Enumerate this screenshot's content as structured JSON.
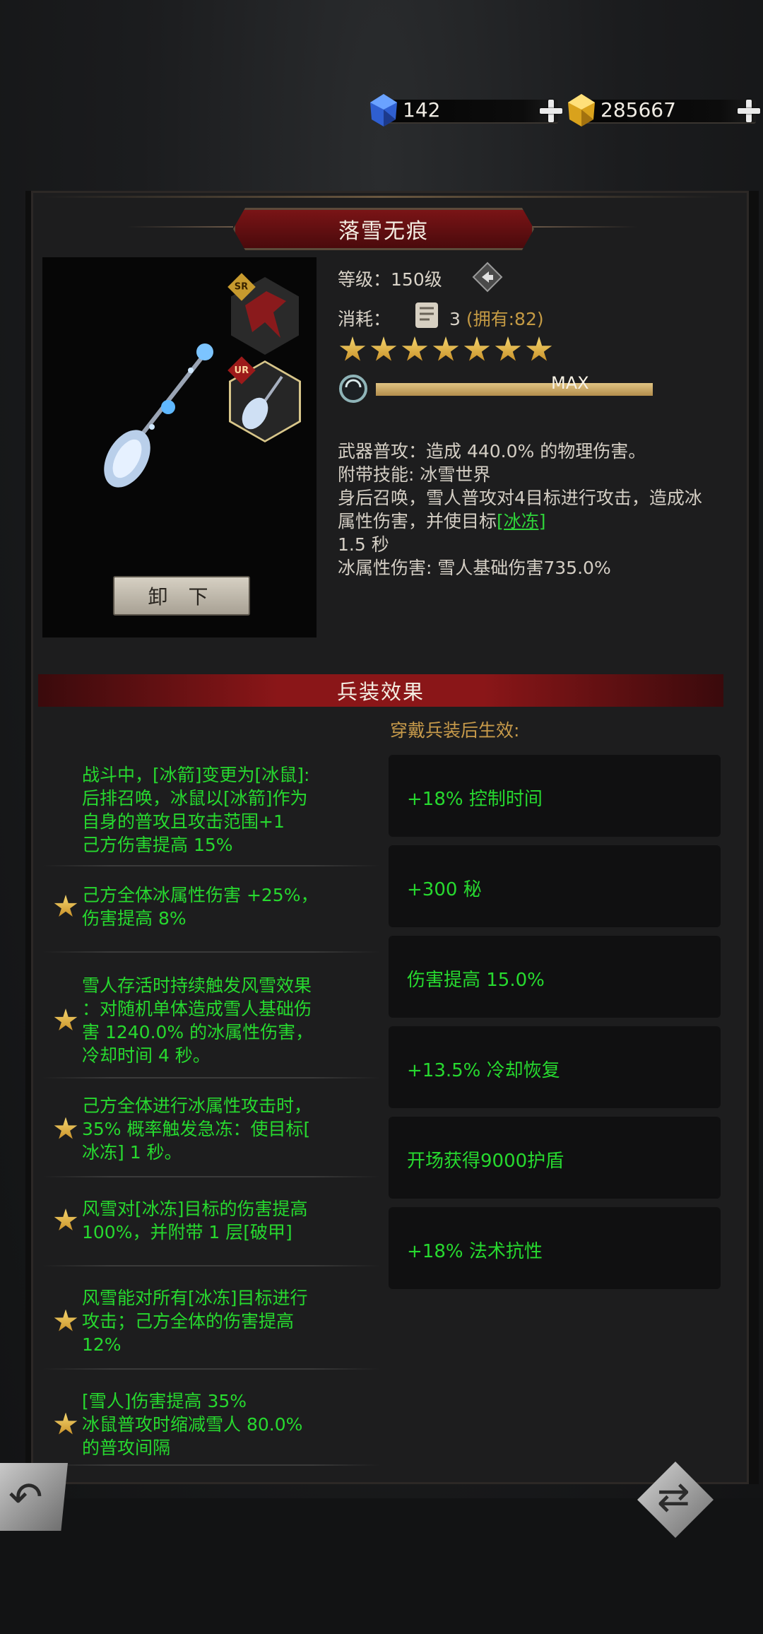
{
  "currency": {
    "gems": "142",
    "gold": "285667",
    "gem_icon": "blue-crystal-icon",
    "gold_icon": "gold-crystal-icon"
  },
  "item": {
    "name": "落雪无痕",
    "unequip_label": "卸 下",
    "sr_badge": "SR",
    "ur_badge": "UR",
    "level_label": "等级：",
    "level_value": "150级",
    "cost_label": "消耗：",
    "cost_value": "3",
    "owned": "(拥有:82)",
    "stars": 7,
    "level_bar_text": "MAX",
    "level_progress": 1.0,
    "description": [
      "武器普攻：造成 440.0% 的物理伤害。",
      "附带技能: 冰雪世界",
      "身后召唤，雪人普攻对4目标进行攻击，造成冰属性伤害，并使目标",
      "[冰冻]",
      "1.5 秒",
      "冰属性伤害: 雪人基础伤害735.0%"
    ]
  },
  "section": {
    "title": "兵装效果",
    "note": "穿戴兵装后生效:"
  },
  "effects": [
    {
      "starred": false,
      "lines": [
        "战斗中，[冰箭]变更为[冰鼠]:",
        "后排召唤，冰鼠以[冰箭]作为",
        "自身的普攻且攻击范围+1",
        "己方伤害提高 15%"
      ]
    },
    {
      "starred": true,
      "lines": [
        "己方全体冰属性伤害 +25%，",
        "伤害提高 8%"
      ]
    },
    {
      "starred": true,
      "lines": [
        "雪人存活时持续触发风雪效果",
        "：对随机单体造成雪人基础伤",
        "害 1240.0% 的冰属性伤害，",
        "冷却时间 4 秒。"
      ]
    },
    {
      "starred": true,
      "lines": [
        "己方全体进行冰属性攻击时，",
        "35% 概率触发急冻：使目标[",
        "冰冻] 1 秒。"
      ]
    },
    {
      "starred": true,
      "lines": [
        "风雪对[冰冻]目标的伤害提高",
        "100%，并附带 1 层[破甲]"
      ]
    },
    {
      "starred": true,
      "lines": [
        "风雪能对所有[冰冻]目标进行",
        "攻击；己方全体的伤害提高",
        "12%"
      ]
    },
    {
      "starred": true,
      "lines": [
        "[雪人]伤害提高 35%",
        "冰鼠普攻时缩减雪人 80.0%",
        "的普攻间隔"
      ]
    }
  ],
  "bonuses": [
    "+18% 控制时间",
    "+300 秘",
    "伤害提高 15.0%",
    "+13.5% 冷却恢复",
    "开场获得9000护盾",
    "+18% 法术抗性"
  ],
  "colors": {
    "effect_green": "#27d92f",
    "owned_gold": "#c49a44",
    "banner_red": "#7a1416"
  },
  "icons": {
    "back": "back-arrow-icon",
    "swap": "swap-icon",
    "level_info": "diamond-arrow-icon"
  }
}
